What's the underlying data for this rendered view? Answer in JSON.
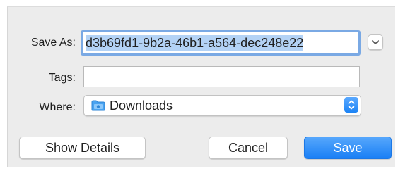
{
  "form": {
    "save_as_label": "Save As:",
    "save_as_value": "d3b69fd1-9b2a-46b1-a564-dec248e22",
    "tags_label": "Tags:",
    "tags_value": "",
    "where_label": "Where:",
    "where_value": "Downloads",
    "where_icon": "folder-icon"
  },
  "buttons": {
    "show_details": "Show Details",
    "cancel": "Cancel",
    "save": "Save"
  },
  "colors": {
    "accent": "#1d84f5",
    "selection": "#b3d2f5",
    "focus_ring": "#7aa9e4",
    "dialog_bg": "#ececec"
  }
}
